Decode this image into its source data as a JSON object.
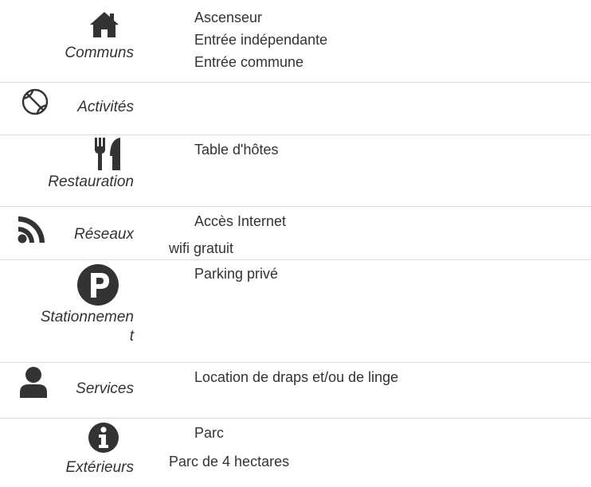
{
  "sections": {
    "communs": {
      "label": "Communs",
      "icon": "home-icon",
      "items": [
        "Ascenseur",
        "Entrée indépendante",
        "Entrée commune"
      ]
    },
    "activites": {
      "label": "Activités",
      "icon": "basketball-icon"
    },
    "restauration": {
      "label": "Restauration",
      "icon": "utensils-icon",
      "items": [
        "Table d'hôtes"
      ]
    },
    "reseaux": {
      "label": "Réseaux",
      "icon": "rss-icon",
      "items": [
        "Accès Internet"
      ],
      "note": "wifi gratuit"
    },
    "stationnement": {
      "label": "Stationnement",
      "icon": "parking-icon",
      "items": [
        "Parking privé"
      ]
    },
    "services": {
      "label": "Services",
      "icon": "user-icon",
      "items": [
        "Location de draps et/ou de linge"
      ]
    },
    "exterieurs": {
      "label": "Extérieurs",
      "icon": "info-icon",
      "items": [
        "Parc"
      ],
      "note": "Parc de 4 hectares"
    }
  },
  "colors": {
    "text": "#333333",
    "divider": "#dcdcdc"
  }
}
